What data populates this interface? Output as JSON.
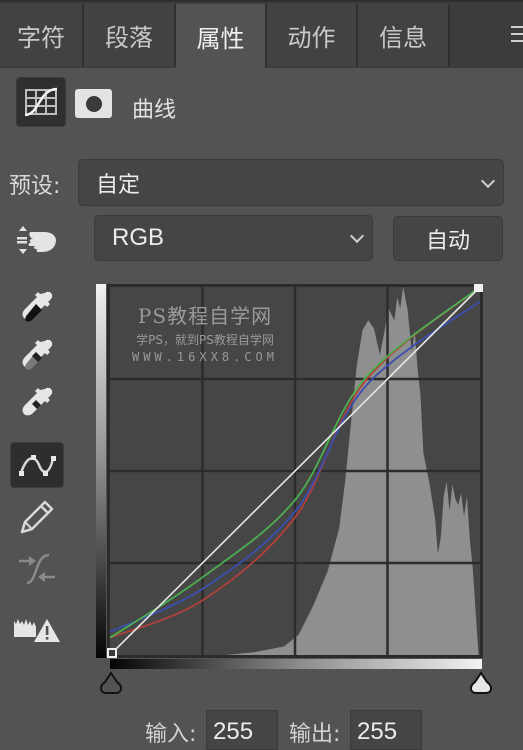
{
  "tabs": [
    {
      "label": "字符",
      "active": false
    },
    {
      "label": "段落",
      "active": false
    },
    {
      "label": "属性",
      "active": true
    },
    {
      "label": "动作",
      "active": false
    },
    {
      "label": "信息",
      "active": false
    }
  ],
  "panel_menu_icon": "hamburger-menu-icon",
  "header": {
    "title": "曲线",
    "icons": [
      "curves-adjustment-icon",
      "layer-mask-icon"
    ]
  },
  "preset": {
    "label": "预设:",
    "value": "自定"
  },
  "channel": {
    "value": "RGB"
  },
  "auto_button": "自动",
  "tools": [
    {
      "name": "on-image-adjust-icon",
      "active": false
    },
    {
      "name": "black-point-eyedropper-icon",
      "active": false
    },
    {
      "name": "gray-point-eyedropper-icon",
      "active": false
    },
    {
      "name": "white-point-eyedropper-icon",
      "active": false
    },
    {
      "name": "edit-points-curve-icon",
      "active": true
    },
    {
      "name": "draw-pencil-icon",
      "active": false
    },
    {
      "name": "smooth-curve-icon",
      "active": false
    },
    {
      "name": "clipping-warning-icon",
      "active": false
    }
  ],
  "watermark": {
    "line1": "PS教程自学网",
    "line2": "学PS，就到PS教程自学网",
    "line3": "WWW.16XX8.COM"
  },
  "curves": {
    "colors": {
      "rgb": "#e6e6e6",
      "red": "#b0403a",
      "green": "#4caf50",
      "blue": "#3a4fb0"
    },
    "rgb_points": [
      [
        0,
        0
      ],
      [
        255,
        255
      ]
    ],
    "red_points": [
      [
        0,
        12
      ],
      [
        64,
        38
      ],
      [
        128,
        96
      ],
      [
        176,
        190
      ],
      [
        255,
        255
      ]
    ],
    "green_points": [
      [
        0,
        12
      ],
      [
        64,
        54
      ],
      [
        128,
        108
      ],
      [
        176,
        192
      ],
      [
        255,
        255
      ]
    ],
    "blue_points": [
      [
        0,
        16
      ],
      [
        64,
        46
      ],
      [
        128,
        100
      ],
      [
        176,
        186
      ],
      [
        255,
        245
      ]
    ]
  },
  "input": {
    "label": "输入:",
    "value": "255"
  },
  "output": {
    "label": "输出:",
    "value": "255"
  }
}
